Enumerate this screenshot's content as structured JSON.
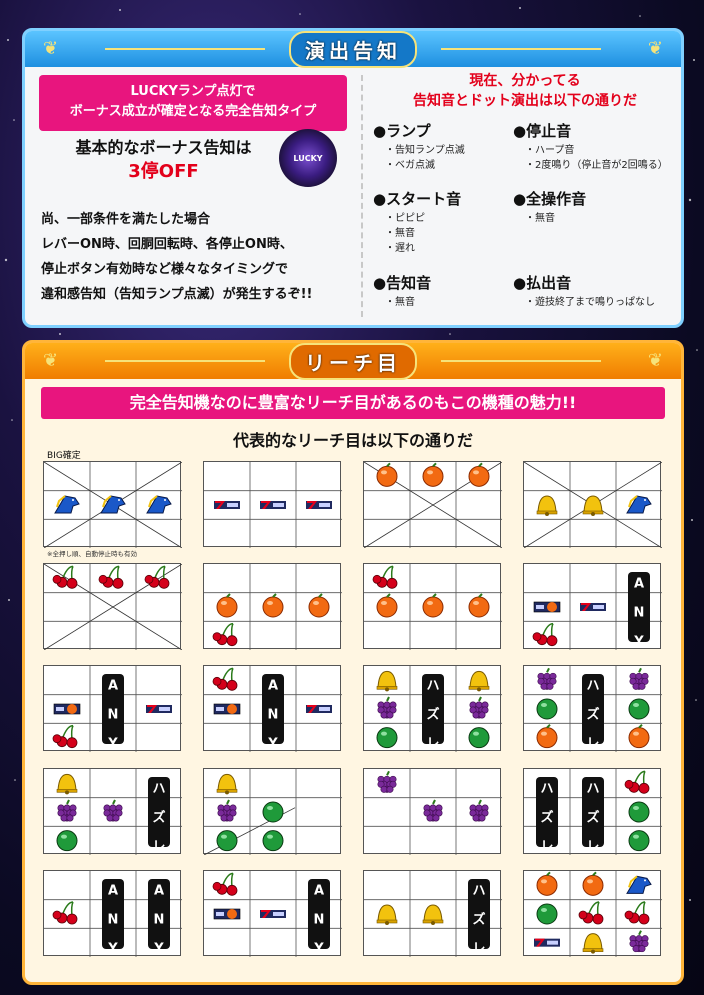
{
  "top": {
    "title": "演出告知",
    "pink_box": [
      "LUCKYランプ点灯で",
      "ボーナス成立が確定となる完全告知タイプ"
    ],
    "basic_line1": "基本的なボーナス告知は",
    "basic_line2": "3停OFF",
    "lamp_text": "LUCKY",
    "paragraph": [
      "尚、一部条件を満たした場合",
      "レバーON時、回胴回転時、各停止ON時、",
      "停止ボタン有効時など様々なタイミングで",
      "違和感告知（告知ランプ点滅）が発生するぞ!!"
    ],
    "right_head": [
      "現在、分かってる",
      "告知音とドット演出は以下の通りだ"
    ],
    "sections": [
      {
        "head": "●ランプ",
        "items": [
          "・告知ランプ点滅",
          "・ベガ点滅"
        ]
      },
      {
        "head": "●停止音",
        "items": [
          "・ハープ音",
          "・2度鳴り（停止音が2回鳴る）"
        ]
      },
      {
        "head": "●スタート音",
        "items": [
          "・ピピピ",
          "・無音",
          "・遅れ"
        ]
      },
      {
        "head": "●全操作音",
        "items": [
          "・無音"
        ]
      },
      {
        "head": "●告知音",
        "items": [
          "・無音"
        ]
      },
      {
        "head": "●払出音",
        "items": [
          "・遊技終了まで鳴りっぱなし"
        ]
      }
    ]
  },
  "bottom": {
    "title": "リーチ目",
    "catch": "完全告知機なのに豊富なリーチ目があるのもこの機種の魅力!!",
    "sub": "代表的なリーチ目は以下の通りだ",
    "big_label": "BIG確定",
    "note": "※全押し順、自動停止時も有効",
    "any": "ANY",
    "hazure": "ハズレ",
    "cells": [
      {
        "sym": [
          [
            "",
            "",
            ""
          ],
          [
            "horse",
            "horse",
            "horse"
          ],
          [
            "",
            "",
            ""
          ]
        ],
        "cross": true
      },
      {
        "sym": [
          [
            "",
            "",
            ""
          ],
          [
            "seven",
            "seven",
            "seven"
          ],
          [
            "",
            "",
            ""
          ]
        ]
      },
      {
        "sym": [
          [
            "orange",
            "orange",
            "orange"
          ],
          [
            "",
            "",
            ""
          ],
          [
            "",
            "",
            ""
          ]
        ],
        "cross": true
      },
      {
        "sym": [
          [
            "",
            "",
            ""
          ],
          [
            "bell",
            "bell",
            "horse"
          ],
          [
            "",
            "",
            ""
          ]
        ],
        "cross": true
      },
      {
        "sym": [
          [
            "cherry",
            "cherry",
            "cherry"
          ],
          [
            "",
            "",
            ""
          ],
          [
            "",
            "",
            ""
          ]
        ],
        "cross": true
      },
      {
        "sym": [
          [
            "",
            "",
            ""
          ],
          [
            "orange",
            "orange",
            "orange"
          ],
          [
            "cherry",
            "",
            ""
          ]
        ]
      },
      {
        "sym": [
          [
            "cherry",
            "",
            ""
          ],
          [
            "orange",
            "orange",
            "orange"
          ],
          [
            "",
            "",
            ""
          ]
        ]
      },
      {
        "sym": [
          [
            "",
            "",
            ""
          ],
          [
            "bar",
            "seven",
            "any"
          ],
          [
            "cherry",
            "",
            ""
          ]
        ]
      },
      {
        "sym": [
          [
            "",
            "",
            ""
          ],
          [
            "bar",
            "any",
            "seven"
          ],
          [
            "cherry",
            "",
            ""
          ]
        ]
      },
      {
        "sym": [
          [
            "cherry",
            "",
            ""
          ],
          [
            "bar",
            "any",
            "seven"
          ],
          [
            "",
            "",
            ""
          ]
        ]
      },
      {
        "sym": [
          [
            "bell",
            "",
            "bell"
          ],
          [
            "grape",
            "hazure",
            "grape"
          ],
          [
            "watermelon",
            "",
            "watermelon"
          ]
        ]
      },
      {
        "sym": [
          [
            "grape",
            "",
            "grape"
          ],
          [
            "watermelon",
            "hazure",
            "watermelon"
          ],
          [
            "orange",
            "",
            "orange"
          ]
        ]
      },
      {
        "sym": [
          [
            "bell",
            "",
            ""
          ],
          [
            "grape",
            "grape",
            "hazure"
          ],
          [
            "watermelon",
            "",
            ""
          ]
        ]
      },
      {
        "sym": [
          [
            "bell",
            "",
            ""
          ],
          [
            "grape",
            "watermelon",
            ""
          ],
          [
            "watermelon",
            "watermelon",
            ""
          ]
        ],
        "diag": true
      },
      {
        "sym": [
          [
            "grape",
            "",
            ""
          ],
          [
            "",
            "grape",
            "grape"
          ],
          [
            "",
            "",
            ""
          ]
        ]
      },
      {
        "sym": [
          [
            "",
            "",
            "cherry"
          ],
          [
            "hazure",
            "hazure",
            "watermelon"
          ],
          [
            "",
            "",
            "watermelon"
          ]
        ]
      },
      {
        "sym": [
          [
            "",
            "",
            ""
          ],
          [
            "cherry",
            "any",
            "any"
          ],
          [
            "",
            "",
            ""
          ]
        ]
      },
      {
        "sym": [
          [
            "cherry",
            "",
            ""
          ],
          [
            "bar",
            "seven",
            "any"
          ],
          [
            "",
            "",
            ""
          ]
        ]
      },
      {
        "sym": [
          [
            "",
            "",
            ""
          ],
          [
            "bell",
            "bell",
            "hazure"
          ],
          [
            "",
            "",
            ""
          ]
        ]
      },
      {
        "sym": [
          [
            "orange",
            "orange",
            "horse"
          ],
          [
            "watermelon",
            "cherry",
            "cherry"
          ],
          [
            "seven",
            "bell",
            "grape"
          ]
        ]
      }
    ]
  }
}
